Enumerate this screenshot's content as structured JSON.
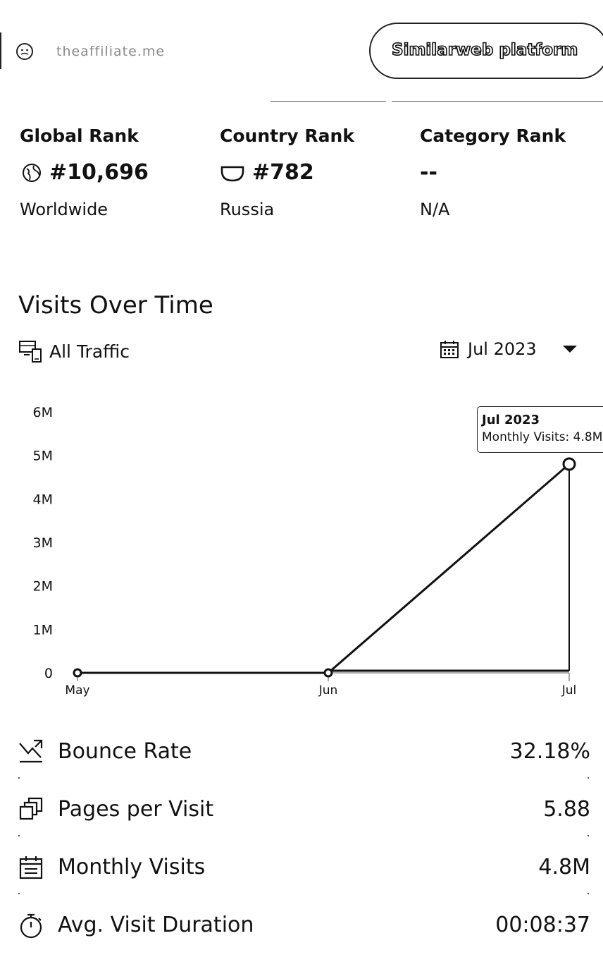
{
  "header": {
    "site_name": "theaffiliate.me",
    "platform_button": "Similarweb platform"
  },
  "ranks": {
    "global": {
      "title": "Global Rank",
      "value": "#10,696",
      "sub": "Worldwide",
      "icon": "globe-icon"
    },
    "country": {
      "title": "Country Rank",
      "value": "#782",
      "sub": "Russia",
      "icon": "flag-icon"
    },
    "category": {
      "title": "Category Rank",
      "value": "--",
      "sub": "N/A"
    }
  },
  "visits": {
    "title": "Visits Over Time",
    "traffic_label": "All Traffic",
    "date_label": "Jul 2023",
    "tooltip": {
      "title": "Jul 2023",
      "line": "Monthly Visits: 4.8M"
    }
  },
  "chart_data": {
    "type": "line",
    "x": [
      "May",
      "Jun",
      "Jul"
    ],
    "series": [
      {
        "values": [
          0,
          0,
          4800000
        ]
      }
    ],
    "y_ticks": [
      "0",
      "1M",
      "2M",
      "3M",
      "4M",
      "5M",
      "6M"
    ],
    "ylim": [
      0,
      6000000
    ],
    "grid": false,
    "line_color": "#111111"
  },
  "metrics": [
    {
      "icon": "bounce-rate-icon",
      "label": "Bounce Rate",
      "value": "32.18%"
    },
    {
      "icon": "pages-icon",
      "label": "Pages per Visit",
      "value": "5.88"
    },
    {
      "icon": "calendar-icon",
      "label": "Monthly Visits",
      "value": "4.8M"
    },
    {
      "icon": "stopwatch-icon",
      "label": "Avg. Visit Duration",
      "value": "00:08:37"
    }
  ]
}
